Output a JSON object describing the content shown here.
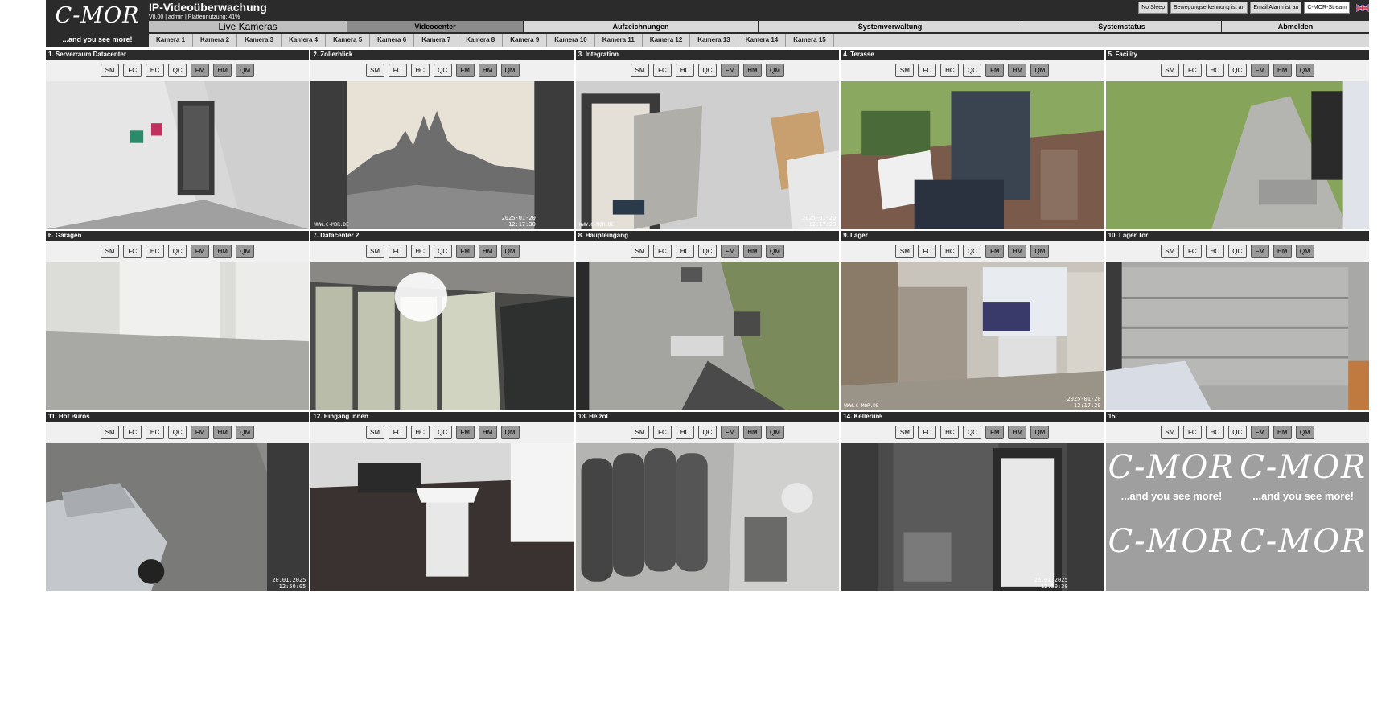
{
  "logo": {
    "text": "C-MOR",
    "slogan": "...and you see more!"
  },
  "header": {
    "title": "IP-Videoüberwachung",
    "subtitle": "V8.00 | admin | Plattennutzung: 41%"
  },
  "status_buttons": [
    "No Sleep",
    "Bewegungserkennung ist an",
    "Email Alarm ist an",
    "C-MOR-Stream"
  ],
  "language_flag": "uk-flag-icon",
  "main_nav": [
    "Live Kameras",
    "Videocenter",
    "Aufzeichnungen",
    "Systemverwaltung",
    "Systemstatus",
    "Abmelden"
  ],
  "camera_nav": [
    "Kamera 1",
    "Kamera 2",
    "Kamera 3",
    "Kamera 4",
    "Kamera 5",
    "Kamera 6",
    "Kamera 7",
    "Kamera 8",
    "Kamera 9",
    "Kamera 10",
    "Kamera 11",
    "Kamera 12",
    "Kamera 13",
    "Kamera 14",
    "Kamera 15"
  ],
  "view_buttons": [
    "SM",
    "FC",
    "HC",
    "QC",
    "FM",
    "HM",
    "QM"
  ],
  "cameras": [
    {
      "title": "1. Serverraum Datacenter",
      "stamp_date": "",
      "stamp_time": ""
    },
    {
      "title": "2. Zollerblick",
      "stamp_date": "2025-01-20",
      "stamp_time": "12:17:30"
    },
    {
      "title": "3. Integration",
      "stamp_date": "2025-01-20",
      "stamp_time": "12:17:29"
    },
    {
      "title": "4. Terasse",
      "stamp_date": "",
      "stamp_time": ""
    },
    {
      "title": "5. Facility",
      "stamp_date": "",
      "stamp_time": ""
    },
    {
      "title": "6. Garagen",
      "stamp_date": "",
      "stamp_time": ""
    },
    {
      "title": "7. Datacenter 2",
      "stamp_date": "",
      "stamp_time": ""
    },
    {
      "title": "8. Haupteingang",
      "stamp_date": "",
      "stamp_time": ""
    },
    {
      "title": "9. Lager",
      "stamp_date": "2025-01-20",
      "stamp_time": "12:17:29"
    },
    {
      "title": "10. Lager Tor",
      "stamp_date": "",
      "stamp_time": ""
    },
    {
      "title": "11. Hof Büros",
      "stamp_date": "20.01.2025",
      "stamp_time": "12:50:05"
    },
    {
      "title": "12. Eingang innen",
      "stamp_date": "",
      "stamp_time": ""
    },
    {
      "title": "13. Heizöl",
      "stamp_date": "",
      "stamp_time": ""
    },
    {
      "title": "14. Kellerüre",
      "stamp_date": "20.01.2025",
      "stamp_time": "12:50:30"
    },
    {
      "title": "15.",
      "stamp_date": "",
      "stamp_time": ""
    }
  ],
  "watermark": "WWW.C-MOR.DE"
}
